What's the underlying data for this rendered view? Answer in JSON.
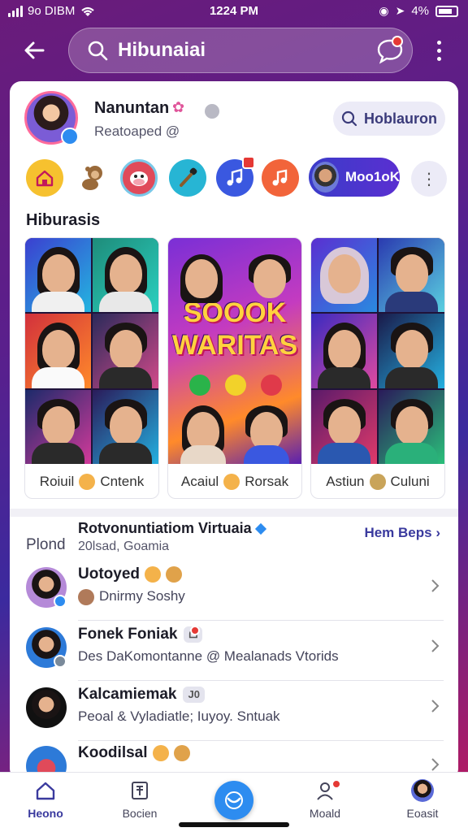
{
  "status_bar": {
    "carrier": "9o DIBM",
    "time": "1224 PM",
    "battery": "4%"
  },
  "top_nav": {
    "search_text": "Hibunaiai"
  },
  "profile": {
    "name": "Nanuntan",
    "subtitle": "Reatoaped @",
    "follow_label": "Hoblauron"
  },
  "icon_strip": {
    "active_label": "Moo1oK"
  },
  "section": {
    "title": "Hiburasis"
  },
  "tiles": [
    {
      "caption": "Roiuil",
      "caption2": "Cntenk"
    },
    {
      "poster_line1": "SOOOK",
      "poster_line2": "WARITAS",
      "caption": "Acaiul",
      "caption2": "Rorsak"
    },
    {
      "caption": "Astiun",
      "caption2": "Culuni"
    }
  ],
  "list_header": {
    "label": "Plond",
    "title": "Rotvonuntiatiom Virtuaia",
    "subtitle": "20lsad, Goamia",
    "more": "Hem Beps"
  },
  "rows": [
    {
      "name": "Uotoyed",
      "detail": "Dnirmy Soshy"
    },
    {
      "name": "Fonek Foniak",
      "detail": "Des DaKomontanne @ Mealanads Vtorids"
    },
    {
      "name": "Kalcamiemak",
      "tag": "J0",
      "detail": "Peoal & Vyladiatle; Iuyoy. Sntuak"
    },
    {
      "name": "Koodilsal"
    }
  ],
  "bottom_nav": {
    "items": [
      {
        "label": "Heono"
      },
      {
        "label": "Bocien"
      },
      {
        "label": "Moald"
      },
      {
        "label": "Eoasit"
      }
    ]
  },
  "colors": {
    "accent": "#3a3a9e",
    "brand_blue": "#2d8cf0",
    "notification": "#e53935"
  },
  "icons": [
    "back-arrow-icon",
    "search-icon",
    "chat-icon",
    "more-vert-icon",
    "home-icon",
    "music-note-icon",
    "chevron-right-icon",
    "profile-icon",
    "book-icon"
  ]
}
